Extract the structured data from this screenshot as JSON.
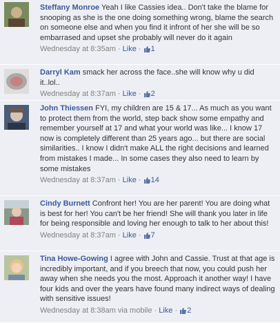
{
  "comments": [
    {
      "author": "Steffany Monroe",
      "text": "Yeah I like Cassies idea.. Don't take the blame for snooping as she is the one doing something wrong, blame the search on someone else and when you find it infront of her she will be so embarrased and upset she probably will never do it again",
      "timestamp": "Wednesday at 8:35am",
      "like_label": "Like",
      "like_count": "1",
      "avatar_colors": [
        "#7a8a5e",
        "#c9b28a"
      ]
    },
    {
      "author": "Darryl Kam",
      "text": "smack her across the face..she will know why u did it..lol..",
      "timestamp": "Wednesday at 8:37am",
      "like_label": "Like",
      "like_count": "2",
      "avatar_colors": [
        "#a9a9a9",
        "#e0dcdc"
      ]
    },
    {
      "author": "John Thiessen",
      "text": "FYI, my children are 15 & 17... As much as you want to protect them from the world, step back show some empathy and remember yourself at 17 and what your world was like... I know 17 now is completely different than 25 years ago... but there are social similarities.. I know I didn't make ALL the right decisions and learned from mistakes I made... In some cases they also need to learn by some mistakes",
      "timestamp": "Wednesday at 8:37am",
      "like_label": "Like",
      "like_count": "14",
      "avatar_colors": [
        "#4b5c78",
        "#d9c4b4"
      ]
    },
    {
      "author": "Cindy Burnett",
      "text": "Confront her! You are her parent! You are doing what is best for her! You can't be her friend! She will thank you later in life for being responsible and loving her enough to talk to her about this!",
      "timestamp": "Wednesday at 8:37am",
      "like_label": "Like",
      "like_count": "7",
      "avatar_colors": [
        "#8a9a8a",
        "#b0475a"
      ]
    },
    {
      "author": "Tina Howe-Gowing",
      "text": "I agree with John and Cassie. Trust at that age is incredibly important, and if you breech that now, you could push her away when she needs you the most. Approach it another way! I have four kids and over the years have found many indirect ways of dealing with sensitive issues!",
      "timestamp": "Wednesday at 8:38am via mobile",
      "like_label": "Like",
      "like_count": "2",
      "avatar_colors": [
        "#b8c4a0",
        "#e6c48a"
      ]
    }
  ]
}
